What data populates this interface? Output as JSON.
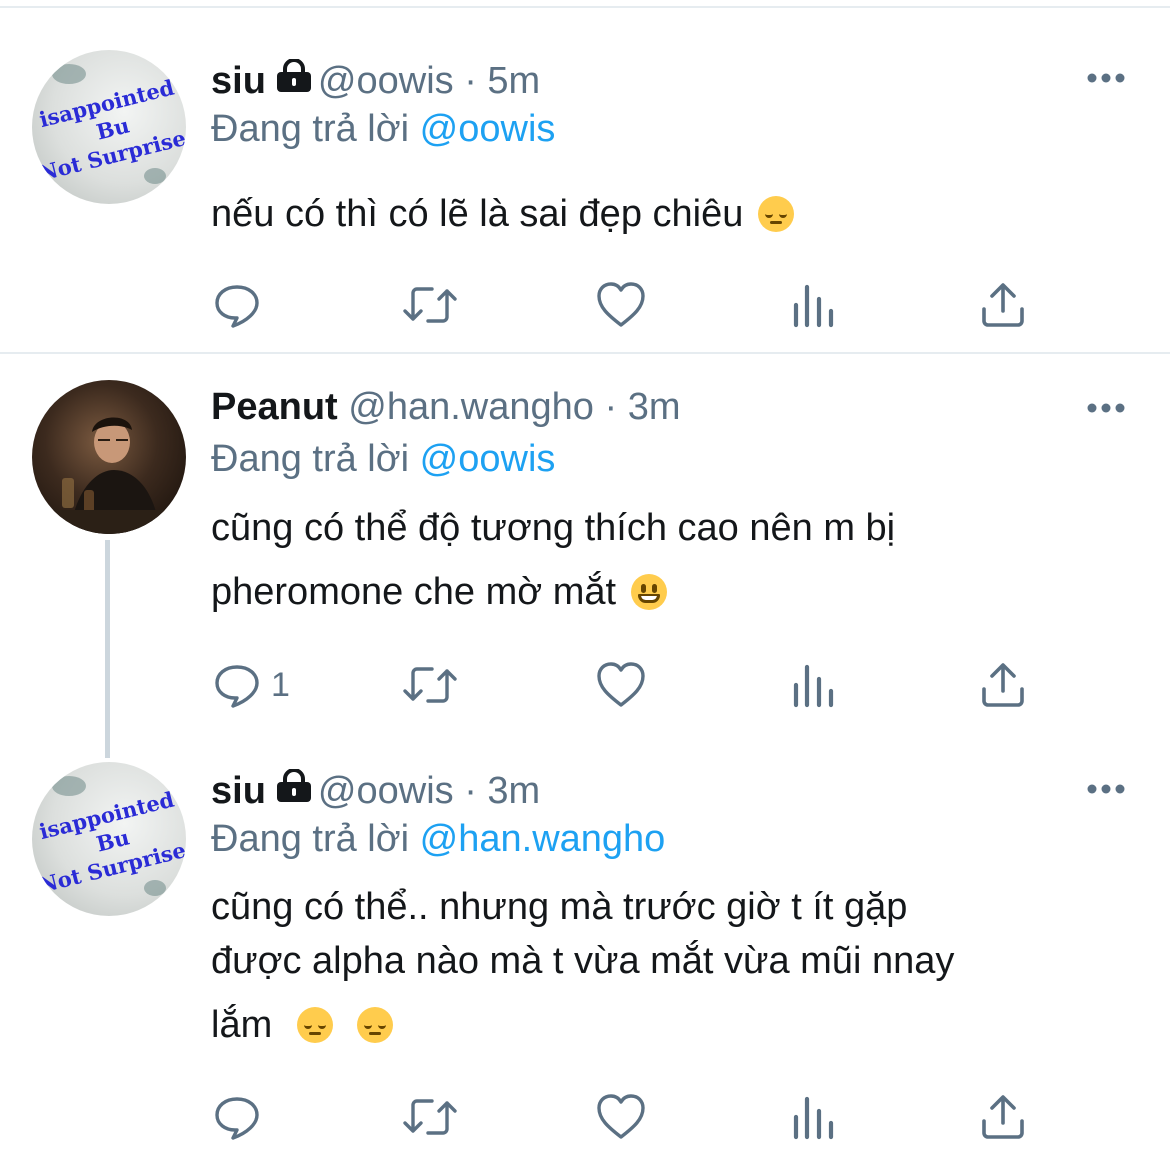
{
  "tweets": [
    {
      "name": "siu",
      "handle": "@oowis",
      "separator": "·",
      "time": "5m",
      "reply_prefix": "Đang trả lời",
      "reply_to": "@oowis",
      "text_lines": [
        "nếu có thì có lẽ là sai đẹp chiêu"
      ],
      "emoji": [
        "pensive-face-emoji"
      ],
      "reply_count": "",
      "locked": true
    },
    {
      "name": "Peanut",
      "handle": "@han.wangho",
      "separator": "·",
      "time": "3m",
      "reply_prefix": "Đang trả lời",
      "reply_to": "@oowis",
      "text_lines": [
        "cũng có thể độ tương thích cao nên m bị",
        "pheromone che mờ mắt"
      ],
      "emoji": [
        "grinning-face-emoji"
      ],
      "reply_count": "1",
      "locked": false
    },
    {
      "name": "siu",
      "handle": "@oowis",
      "separator": "·",
      "time": "3m",
      "reply_prefix": "Đang trả lời",
      "reply_to": "@han.wangho",
      "text_lines": [
        "cũng có thể.. nhưng mà trước giờ t ít gặp",
        "được alpha nào mà t vừa mắt vừa mũi nnay",
        "lắm"
      ],
      "emoji": [
        "pensive-face-emoji",
        "pensive-face-emoji"
      ],
      "reply_count": "",
      "locked": true
    }
  ],
  "avatar_text": [
    "isappointed Bu",
    "Not Surprised"
  ],
  "icons": [
    "reply-icon",
    "retweet-icon",
    "like-icon",
    "analytics-icon",
    "share-icon",
    "more-options-icon",
    "lock-icon"
  ],
  "colors": {
    "text": "#14171a",
    "secondary": "#5b7083",
    "link": "#1da1f2",
    "divider": "#e6ecf0"
  }
}
